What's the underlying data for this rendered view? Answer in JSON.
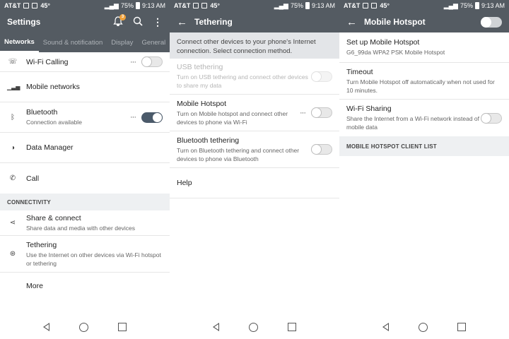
{
  "status_bar": {
    "carrier": "AT&T",
    "temperature": "45°",
    "battery": "75%",
    "time": "9:13 AM"
  },
  "colors": {
    "header_bg": "#545b62",
    "toggle_on": "#4b5a6a",
    "badge": "#f0a23c"
  },
  "settings": {
    "title": "Settings",
    "notification_badge": "3",
    "tabs": [
      "Networks",
      "Sound & notification",
      "Display",
      "General"
    ],
    "items": [
      {
        "icon": "wifi-calling-icon",
        "label": "Wi-Fi Calling",
        "sub": "",
        "toggle": "off",
        "more": "···"
      },
      {
        "icon": "signal-bars-icon",
        "label": "Mobile networks",
        "sub": ""
      },
      {
        "icon": "bluetooth-icon",
        "label": "Bluetooth",
        "sub": "Connection available",
        "toggle": "on",
        "more": "···"
      },
      {
        "icon": "data-manager-icon",
        "label": "Data Manager",
        "sub": ""
      },
      {
        "icon": "phone-icon",
        "label": "Call",
        "sub": ""
      }
    ],
    "section_connectivity": "CONNECTIVITY",
    "connectivity": [
      {
        "icon": "share-icon",
        "label": "Share & connect",
        "sub": "Share data and media with other devices"
      },
      {
        "icon": "tethering-icon",
        "label": "Tethering",
        "sub": "Use the Internet on other devices via Wi-Fi hotspot or tethering"
      },
      {
        "icon": "",
        "label": "More",
        "sub": ""
      }
    ]
  },
  "tethering": {
    "title": "Tethering",
    "info": "Connect other devices to your phone's Internet connection. Select connection method.",
    "items": [
      {
        "label": "USB tethering",
        "sub": "Turn on USB tethering and connect other devices to share my data",
        "toggle": "off",
        "disabled": true
      },
      {
        "label": "Mobile Hotspot",
        "sub": "Turn on Mobile hotspot and connect other devices to phone via Wi-Fi",
        "toggle": "off",
        "more": "···"
      },
      {
        "label": "Bluetooth tethering",
        "sub": "Turn on Bluetooth tethering and connect other devices to phone via Bluetooth",
        "toggle": "off"
      },
      {
        "label": "Help",
        "sub": ""
      }
    ]
  },
  "hotspot": {
    "title": "Mobile Hotspot",
    "master_toggle": "off",
    "items": [
      {
        "label": "Set up Mobile Hotspot",
        "sub": "G6_99da WPA2 PSK Mobile Hotspot"
      },
      {
        "label": "Timeout",
        "sub": "Turn Mobile Hotspot off automatically when not used for 10 minutes."
      },
      {
        "label": "Wi-Fi Sharing",
        "sub": "Share the Internet from a Wi-Fi network instead of mobile data",
        "toggle": "off"
      }
    ],
    "section_clients": "MOBILE HOTSPOT CLIENT LIST"
  }
}
